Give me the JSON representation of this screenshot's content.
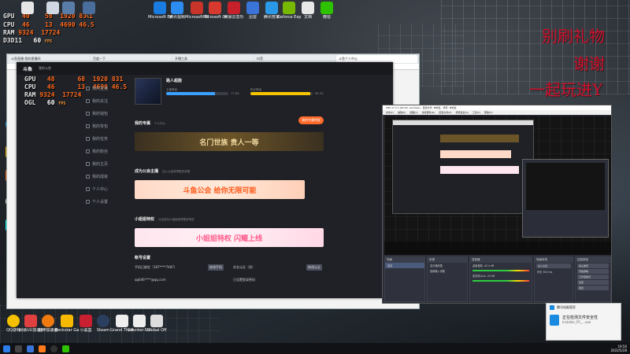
{
  "overlay_top": {
    "gpu_label": "GPU",
    "gpu_temp": "40",
    "gpu_load": "58",
    "gpu_clock": "1920",
    "gpu_fan": "83",
    "gpu_fan_unit": "%",
    "gpu_power": "1",
    "cpu_label": "CPU",
    "cpu_temp": "46",
    "cpu_load": "13",
    "cpu_clock": "4690",
    "cpu_power": "46.5",
    "ram_label": "RAM",
    "ram_used": "9324",
    "ram_mb": "17724",
    "api_label": "D3D11",
    "fps": "60",
    "fps_unit": "FPS"
  },
  "overlay_app": {
    "gpu_label": "GPU",
    "gpu_temp": "48",
    "gpu_load": "68",
    "gpu_clock": "1920",
    "gpu_fan": "83",
    "gpu_power": "1",
    "cpu_label": "CPU",
    "cpu_temp": "46",
    "cpu_load": "13",
    "cpu_clock": "4690",
    "cpu_power": "46.5",
    "ram_label": "RAM",
    "ram_used": "9324",
    "ram_mb": "17724",
    "api_label": "OGL",
    "fps": "60",
    "fps_unit": "FPS"
  },
  "red_text": {
    "line1": "别刷礼物",
    "line2": "谢谢",
    "line3": "一起玩进Y"
  },
  "desktop_icons": [
    {
      "label": "此电脑"
    },
    {
      "label": "回收站"
    },
    {
      "label": "Microsoft Edge"
    },
    {
      "label": "QQ"
    },
    {
      "label": "酷狗"
    },
    {
      "label": "WeGame"
    },
    {
      "label": "OBS Studio"
    },
    {
      "label": "TikTok"
    }
  ],
  "top_icons": [
    {
      "label": "Microsoft Edge"
    },
    {
      "label": "腾讯视频"
    },
    {
      "label": "Microsoft Office Pro"
    },
    {
      "label": "Microsoft Office Ex"
    },
    {
      "label": "网易云音乐"
    },
    {
      "label": "迅雷"
    },
    {
      "label": "腾讯管家"
    },
    {
      "label": "Geforce Experience"
    },
    {
      "label": "文档"
    },
    {
      "label": "微信"
    }
  ],
  "bottom_icons": [
    {
      "label": "QQ游戏"
    },
    {
      "label": "网易UU加速器"
    },
    {
      "label": "雷神加速器"
    },
    {
      "label": "Rockstar Games"
    },
    {
      "label": "小黑盒"
    },
    {
      "label": "Steam"
    },
    {
      "label": "Grand Theft Auto V"
    },
    {
      "label": "Counter-Strike"
    },
    {
      "label": "Global Off"
    }
  ],
  "browser": {
    "tabs": [
      "斗鱼直播-我的直播间",
      "百度一下",
      "开播工具",
      "抖音",
      "斗鱼个人中心"
    ],
    "app": {
      "logo": "斗鱼",
      "crumb": "我的斗鱼",
      "sidebar": [
        "我的直播",
        "我的关注",
        "我的钱包",
        "我的背包",
        "我的任务",
        "我的粉丝",
        "我的主页",
        "我的成就",
        "个人中心",
        "个人设置"
      ],
      "user_name": "路人超能",
      "level_label": "主播等级",
      "level_pct": "77.8%",
      "level_fill": 0.78,
      "fans_label": "粉丝等级",
      "fans_pct": "96.3%",
      "fans_fill": 0.96,
      "privilege_title": "我的专属",
      "privilege_sub": "个人中心",
      "privilege_btn": "我的专属特权",
      "banner1": "名门世族 贵人一等",
      "guild_title": "成为公会主播",
      "guild_sub": "加入公会获得更多资源",
      "banner2": "斗鱼公会 给你无限可能",
      "bonus_title": "小姐姐特权",
      "bonus_sub": "认证成为小姐姐获得更多特权",
      "banner3": "小姐姐特权 闪耀上线",
      "account_title": "帐号设置",
      "phone_label": "手机已绑定（187****7487）",
      "phone_btn": "修改手机",
      "realname_label": "实名认证（男）",
      "realname_btn": "修改认证",
      "email_label": "qq646****@qq.com",
      "email_btn": "",
      "pwd_label": "已设置登录密码"
    }
  },
  "obs": {
    "title": "OBS 27.2.4 (64-bit, windows) - 配置文件: 未命名 - 场景: 未命名",
    "menu": [
      "文件(F)",
      "编辑(E)",
      "视图(V)",
      "停靠部件(D)",
      "配置文件(P)",
      "场景集合(S)",
      "工具(T)",
      "帮助(H)"
    ],
    "scenes_title": "场景",
    "scenes": [
      "场景"
    ],
    "sources_title": "来源",
    "sources": [
      "显示器采集",
      "音频输入采集"
    ],
    "mixer_title": "混音器",
    "mixer": [
      {
        "name": "桌面音频",
        "db": "-42.4 dB"
      },
      {
        "name": "麦克风/Aux",
        "db": "-inf dB"
      }
    ],
    "transition_title": "场景转场",
    "transition": "淡入淡出",
    "duration_label": "时长",
    "duration": "300 ms",
    "controls_title": "控制按钮",
    "controls": [
      "停止推流",
      "开始录制",
      "工作室模式",
      "设置",
      "退出"
    ]
  },
  "notification": {
    "title": "腾讯电脑管家",
    "line1": "正在检测文件安全性",
    "line2": "Installer_PC_...exe"
  },
  "taskbar": {
    "time": "19:50",
    "date": "2022/5/28"
  }
}
